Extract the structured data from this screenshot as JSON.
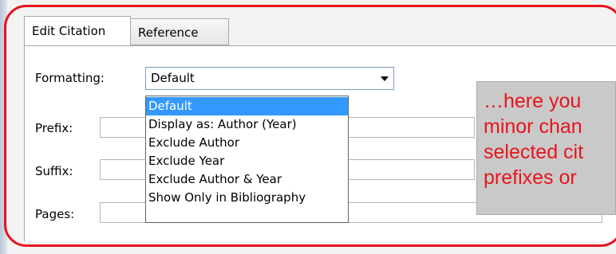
{
  "tabs": [
    {
      "label": "Edit Citation"
    },
    {
      "label": "Reference"
    }
  ],
  "form": {
    "formatting_label": "Formatting:",
    "formatting_value": "Default",
    "prefix_label": "Prefix:",
    "suffix_label": "Suffix:",
    "pages_label": "Pages:"
  },
  "dropdown_options": [
    {
      "label": "Default",
      "selected": true
    },
    {
      "label": "Display as: Author (Year)"
    },
    {
      "label": "Exclude Author"
    },
    {
      "label": "Exclude Year"
    },
    {
      "label": "Exclude Author & Year"
    },
    {
      "label": "Show Only in Bibliography"
    }
  ],
  "callout": {
    "lines": [
      "…here you",
      "minor chan",
      "selected cit",
      "prefixes or"
    ]
  },
  "colors": {
    "annotation": "#e8141c",
    "selection": "#3399ff"
  }
}
